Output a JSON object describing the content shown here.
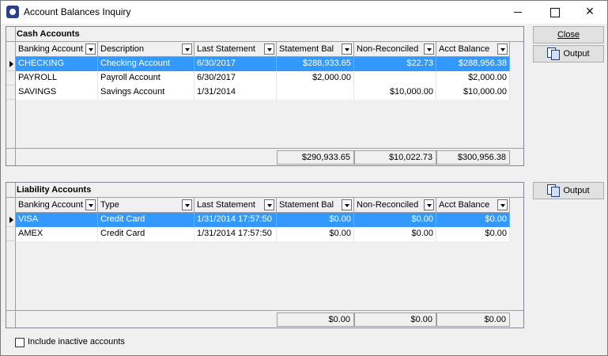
{
  "window": {
    "title": "Account Balances Inquiry"
  },
  "buttons": {
    "close": "Close",
    "output": "Output"
  },
  "cash": {
    "caption": "Cash Accounts",
    "headers": [
      "Banking Account",
      "Description",
      "Last Statement",
      "Statement Bal",
      "Non-Reconciled",
      "Acct Balance"
    ],
    "rows": [
      [
        "CHECKING",
        "Checking Account",
        "6/30/2017",
        "$288,933.65",
        "$22.73",
        "$288,956.38"
      ],
      [
        "PAYROLL",
        "Payroll Account",
        "6/30/2017",
        "$2,000.00",
        "",
        "$2,000.00"
      ],
      [
        "SAVINGS",
        "Savings Account",
        "1/31/2014",
        "",
        "$10,000.00",
        "$10,000.00"
      ]
    ],
    "totals": [
      "$290,933.65",
      "$10,022.73",
      "$300,956.38"
    ]
  },
  "liability": {
    "caption": "Liability Accounts",
    "headers": [
      "Banking Account",
      "Type",
      "Last Statement",
      "Statement Bal",
      "Non-Reconciled",
      "Acct Balance"
    ],
    "rows": [
      [
        "VISA",
        "Credit Card",
        "1/31/2014 17:57:50",
        "$0.00",
        "$0.00",
        "$0.00"
      ],
      [
        "AMEX",
        "Credit Card",
        "1/31/2014 17:57:50",
        "$0.00",
        "$0.00",
        "$0.00"
      ]
    ],
    "totals": [
      "$0.00",
      "$0.00",
      "$0.00"
    ]
  },
  "options": {
    "include_inactive": "Include inactive accounts"
  },
  "colors": {
    "selection": "#3399ff",
    "window_bg": "#f0f0f0"
  }
}
